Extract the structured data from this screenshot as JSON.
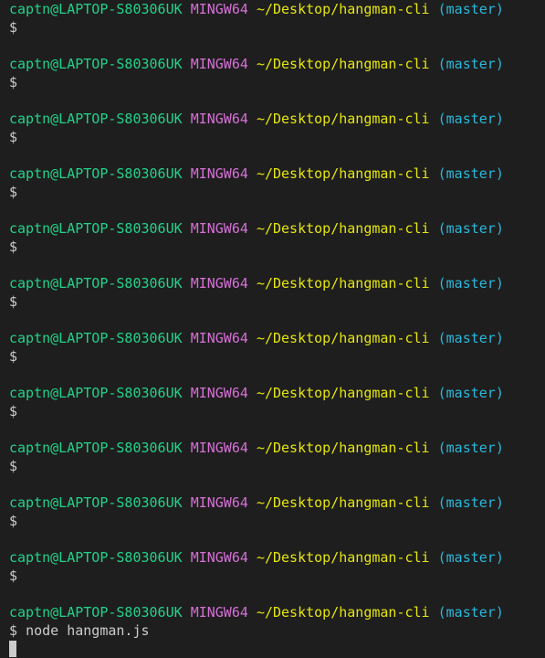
{
  "terminal": {
    "user_host": "captn@LAPTOP-S80306UK",
    "shell": "MINGW64",
    "path": "~/Desktop/hangman-cli",
    "branch": "(master)",
    "prompt_symbol": "$",
    "last_command": "node hangman.js",
    "prompt_count": 12
  },
  "colors": {
    "background": "#1e1e1e",
    "user_host": "#23d18b",
    "shell": "#d670d6",
    "path": "#e5e510",
    "branch": "#29b8db",
    "text": "#cccccc"
  }
}
